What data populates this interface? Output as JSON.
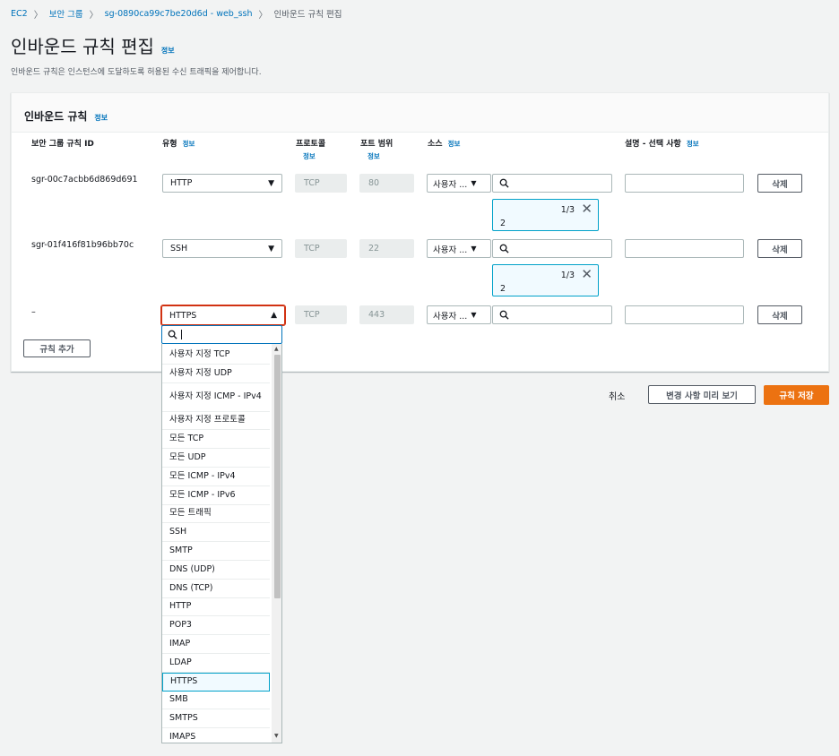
{
  "breadcrumb": {
    "items": [
      "EC2",
      "보안 그룹",
      "sg-0890ca99c7be20d6d - web_ssh"
    ],
    "current": "인바운드 규칙 편집"
  },
  "page": {
    "title": "인바운드 규칙 편집",
    "info": "정보",
    "description": "인바운드 규칙은 인스턴스에 도달하도록 허용된 수신 트래픽을 제어합니다."
  },
  "panel": {
    "title": "인바운드 규칙",
    "info": "정보",
    "columns": {
      "rule_id": "보안 그룹 규칙 ID",
      "type": "유형",
      "protocol": "프로토콜",
      "port_range": "포트 범위",
      "source": "소스",
      "description": "설명 - 선택 사항",
      "info": "정보"
    },
    "rules": [
      {
        "id": "sgr-00c7acbb6d869d691",
        "type": "HTTP",
        "protocol": "TCP",
        "port": "80",
        "source_type": "사용자 ...",
        "token_count": "1/3",
        "token_value": "2",
        "delete_label": "삭제"
      },
      {
        "id": "sgr-01f416f81b96bb70c",
        "type": "SSH",
        "protocol": "TCP",
        "port": "22",
        "source_type": "사용자 ...",
        "token_count": "1/3",
        "token_value": "2",
        "delete_label": "삭제"
      },
      {
        "id": "–",
        "type": "HTTPS",
        "protocol": "TCP",
        "port": "443",
        "source_type": "사용자 ...",
        "delete_label": "삭제"
      }
    ],
    "add_rule_label": "규칙 추가"
  },
  "dropdown": {
    "options": [
      "사용자 지정 TCP",
      "사용자 지정 UDP",
      "사용자 지정 ICMP - IPv4",
      "사용자 지정 프로토콜",
      "모든 TCP",
      "모든 UDP",
      "모든 ICMP - IPv4",
      "모든 ICMP - IPv6",
      "모든 트래픽",
      "SSH",
      "SMTP",
      "DNS (UDP)",
      "DNS (TCP)",
      "HTTP",
      "POP3",
      "IMAP",
      "LDAP",
      "HTTPS",
      "SMB",
      "SMTPS",
      "IMAPS"
    ],
    "selected": "HTTPS"
  },
  "footer": {
    "cancel_label": "취소",
    "preview_label": "변경 사항 미리 보기",
    "save_label": "규칙 저장"
  },
  "colors": {
    "link": "#0073bb",
    "primary": "#ec7211",
    "focus": "#00a1c9",
    "error_outline": "#d13212"
  }
}
